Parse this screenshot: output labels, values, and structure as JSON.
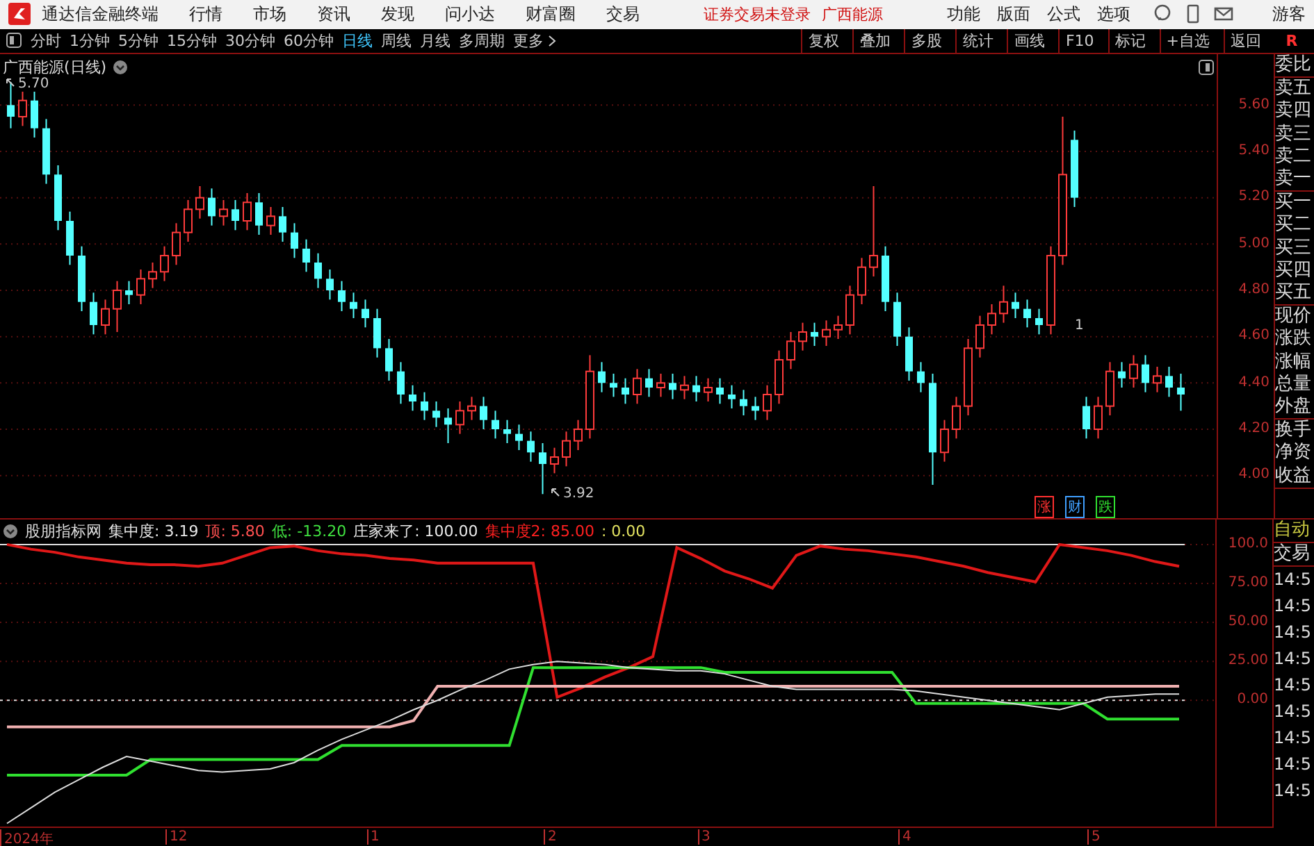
{
  "top_bar": {
    "app_name": "通达信金融终端",
    "menu": [
      "行情",
      "市场",
      "资讯",
      "发现",
      "问小达",
      "财富圈",
      "交易"
    ],
    "notice": "证券交易未登录",
    "stock_link": "广西能源",
    "right_menu": [
      "功能",
      "版面",
      "公式",
      "选项"
    ],
    "user": "游客"
  },
  "period_tabs": [
    {
      "label": "分时",
      "selected": false
    },
    {
      "label": "1分钟",
      "selected": false
    },
    {
      "label": "5分钟",
      "selected": false
    },
    {
      "label": "15分钟",
      "selected": false
    },
    {
      "label": "30分钟",
      "selected": false
    },
    {
      "label": "60分钟",
      "selected": false
    },
    {
      "label": "日线",
      "selected": true
    },
    {
      "label": "周线",
      "selected": false
    },
    {
      "label": "月线",
      "selected": false
    },
    {
      "label": "多周期",
      "selected": false
    },
    {
      "label": "更多",
      "selected": false
    }
  ],
  "tool_buttons": [
    "复权",
    "叠加",
    "多股",
    "统计",
    "画线",
    "F10",
    "标记",
    "+自选",
    "返回"
  ],
  "corner_label": "R",
  "main_chart": {
    "title": "广西能源(日线)",
    "high_label": "5.70",
    "low_label": "3.92",
    "note_mark": "1",
    "markers": [
      {
        "label": "涨",
        "color": "#ff3030"
      },
      {
        "label": "财",
        "color": "#40a0ff"
      },
      {
        "label": "跌",
        "color": "#30e030"
      }
    ],
    "chart_data": {
      "type": "candlestick",
      "grid": true,
      "ylim": [
        3.81,
        5.82
      ],
      "yticks": [
        {
          "value": 5.6,
          "label": "5.60"
        },
        {
          "value": 5.4,
          "label": "5.40"
        },
        {
          "value": 5.2,
          "label": "5.20"
        },
        {
          "value": 5.0,
          "label": "5.00"
        },
        {
          "value": 4.8,
          "label": "4.80"
        },
        {
          "value": 4.6,
          "label": "4.60"
        },
        {
          "value": 4.4,
          "label": "4.40"
        },
        {
          "value": 4.2,
          "label": "4.20"
        },
        {
          "value": 4.0,
          "label": "4.00"
        }
      ],
      "ohlc": [
        [
          5.6,
          5.7,
          5.5,
          5.55
        ],
        [
          5.55,
          5.66,
          5.51,
          5.62
        ],
        [
          5.62,
          5.66,
          5.46,
          5.5
        ],
        [
          5.5,
          5.54,
          5.26,
          5.3
        ],
        [
          5.3,
          5.34,
          5.06,
          5.1
        ],
        [
          5.1,
          5.14,
          4.91,
          4.95
        ],
        [
          4.95,
          4.99,
          4.71,
          4.75
        ],
        [
          4.75,
          4.79,
          4.61,
          4.65
        ],
        [
          4.65,
          4.76,
          4.61,
          4.72
        ],
        [
          4.72,
          4.84,
          4.62,
          4.8
        ],
        [
          4.8,
          4.84,
          4.74,
          4.78
        ],
        [
          4.78,
          4.89,
          4.74,
          4.85
        ],
        [
          4.85,
          4.92,
          4.81,
          4.88
        ],
        [
          4.88,
          4.99,
          4.84,
          4.95
        ],
        [
          4.95,
          5.09,
          4.91,
          5.05
        ],
        [
          5.05,
          5.19,
          5.01,
          5.15
        ],
        [
          5.15,
          5.25,
          5.11,
          5.2
        ],
        [
          5.2,
          5.24,
          5.08,
          5.12
        ],
        [
          5.12,
          5.19,
          5.08,
          5.15
        ],
        [
          5.15,
          5.19,
          5.06,
          5.1
        ],
        [
          5.1,
          5.22,
          5.06,
          5.18
        ],
        [
          5.18,
          5.22,
          5.04,
          5.08
        ],
        [
          5.08,
          5.16,
          5.04,
          5.12
        ],
        [
          5.12,
          5.16,
          5.01,
          5.05
        ],
        [
          5.05,
          5.09,
          4.94,
          4.98
        ],
        [
          4.98,
          5.02,
          4.88,
          4.92
        ],
        [
          4.92,
          4.96,
          4.81,
          4.85
        ],
        [
          4.85,
          4.89,
          4.76,
          4.8
        ],
        [
          4.8,
          4.84,
          4.71,
          4.75
        ],
        [
          4.75,
          4.79,
          4.68,
          4.72
        ],
        [
          4.72,
          4.76,
          4.64,
          4.68
        ],
        [
          4.68,
          4.72,
          4.51,
          4.55
        ],
        [
          4.55,
          4.59,
          4.41,
          4.45
        ],
        [
          4.45,
          4.49,
          4.31,
          4.35
        ],
        [
          4.35,
          4.39,
          4.28,
          4.32
        ],
        [
          4.32,
          4.36,
          4.24,
          4.28
        ],
        [
          4.28,
          4.32,
          4.21,
          4.25
        ],
        [
          4.25,
          4.29,
          4.14,
          4.22
        ],
        [
          4.22,
          4.32,
          4.18,
          4.28
        ],
        [
          4.28,
          4.34,
          4.24,
          4.3
        ],
        [
          4.3,
          4.34,
          4.2,
          4.24
        ],
        [
          4.24,
          4.28,
          4.16,
          4.2
        ],
        [
          4.2,
          4.24,
          4.14,
          4.18
        ],
        [
          4.18,
          4.22,
          4.11,
          4.15
        ],
        [
          4.15,
          4.19,
          4.06,
          4.1
        ],
        [
          4.1,
          4.14,
          3.92,
          4.05
        ],
        [
          4.05,
          4.12,
          4.01,
          4.08
        ],
        [
          4.08,
          4.19,
          4.04,
          4.15
        ],
        [
          4.15,
          4.24,
          4.11,
          4.2
        ],
        [
          4.2,
          4.52,
          4.16,
          4.45
        ],
        [
          4.45,
          4.49,
          4.36,
          4.4
        ],
        [
          4.4,
          4.44,
          4.34,
          4.38
        ],
        [
          4.38,
          4.42,
          4.31,
          4.35
        ],
        [
          4.35,
          4.46,
          4.31,
          4.42
        ],
        [
          4.42,
          4.46,
          4.34,
          4.38
        ],
        [
          4.38,
          4.44,
          4.34,
          4.4
        ],
        [
          4.4,
          4.44,
          4.33,
          4.37
        ],
        [
          4.37,
          4.43,
          4.33,
          4.39
        ],
        [
          4.39,
          4.43,
          4.32,
          4.36
        ],
        [
          4.36,
          4.42,
          4.32,
          4.38
        ],
        [
          4.38,
          4.42,
          4.31,
          4.35
        ],
        [
          4.35,
          4.39,
          4.29,
          4.33
        ],
        [
          4.33,
          4.37,
          4.26,
          4.3
        ],
        [
          4.3,
          4.34,
          4.24,
          4.28
        ],
        [
          4.28,
          4.39,
          4.24,
          4.35
        ],
        [
          4.35,
          4.54,
          4.31,
          4.5
        ],
        [
          4.5,
          4.62,
          4.46,
          4.58
        ],
        [
          4.58,
          4.66,
          4.54,
          4.62
        ],
        [
          4.62,
          4.66,
          4.56,
          4.6
        ],
        [
          4.6,
          4.67,
          4.56,
          4.63
        ],
        [
          4.63,
          4.69,
          4.59,
          4.65
        ],
        [
          4.65,
          4.82,
          4.61,
          4.78
        ],
        [
          4.78,
          4.94,
          4.74,
          4.9
        ],
        [
          4.9,
          5.25,
          4.86,
          4.95
        ],
        [
          4.95,
          4.99,
          4.71,
          4.75
        ],
        [
          4.75,
          4.79,
          4.56,
          4.6
        ],
        [
          4.6,
          4.64,
          4.41,
          4.45
        ],
        [
          4.45,
          4.49,
          4.36,
          4.4
        ],
        [
          4.4,
          4.44,
          3.96,
          4.1
        ],
        [
          4.1,
          4.24,
          4.06,
          4.2
        ],
        [
          4.2,
          4.34,
          4.16,
          4.3
        ],
        [
          4.3,
          4.59,
          4.26,
          4.55
        ],
        [
          4.55,
          4.69,
          4.51,
          4.65
        ],
        [
          4.65,
          4.74,
          4.61,
          4.7
        ],
        [
          4.7,
          4.82,
          4.66,
          4.75
        ],
        [
          4.75,
          4.79,
          4.68,
          4.72
        ],
        [
          4.72,
          4.76,
          4.64,
          4.68
        ],
        [
          4.68,
          4.72,
          4.61,
          4.65
        ],
        [
          4.65,
          4.99,
          4.61,
          4.95
        ],
        [
          4.95,
          5.55,
          4.91,
          5.3
        ],
        [
          5.45,
          5.49,
          5.16,
          5.2
        ],
        [
          4.3,
          4.34,
          4.16,
          4.2
        ],
        [
          4.2,
          4.34,
          4.16,
          4.3
        ],
        [
          4.3,
          4.49,
          4.26,
          4.45
        ],
        [
          4.45,
          4.49,
          4.38,
          4.42
        ],
        [
          4.42,
          4.52,
          4.38,
          4.48
        ],
        [
          4.48,
          4.52,
          4.36,
          4.4
        ],
        [
          4.4,
          4.47,
          4.36,
          4.43
        ],
        [
          4.43,
          4.47,
          4.34,
          4.38
        ],
        [
          4.38,
          4.44,
          4.28,
          4.35
        ]
      ]
    }
  },
  "quote_panel": [
    [
      "委比"
    ],
    [
      "卖五",
      "卖四",
      "卖三",
      "卖二",
      "卖一"
    ],
    [
      "买一",
      "买二",
      "买三",
      "买四",
      "买五"
    ],
    [
      "现价",
      "涨跌",
      "涨幅",
      "总量",
      "外盘"
    ],
    [
      "换手",
      "净资",
      "收益"
    ]
  ],
  "indicator": {
    "name": "股朋指标网",
    "values": [
      {
        "text": "集中度: 3.19",
        "color": "#e8e8e8"
      },
      {
        "text": "顶: 5.80",
        "color": "#ff5050"
      },
      {
        "text": "低: -13.20",
        "color": "#40e040"
      },
      {
        "text": "庄家来了: 100.00",
        "color": "#e8e8e8"
      },
      {
        "text": "集中度2: 85.00",
        "color": "#ff2020"
      },
      {
        "text": ": 0.00",
        "color": "#e0e060"
      }
    ],
    "chart_data": {
      "type": "line",
      "grid": true,
      "ylim": [
        -81,
        116
      ],
      "ref_lines": [
        {
          "axis": "y",
          "value": 100,
          "color": "#dddddd"
        },
        {
          "axis": "y",
          "value": 0,
          "color": "#dddddd"
        }
      ],
      "yticks": [
        {
          "value": 100,
          "label": "100.0"
        },
        {
          "value": 75,
          "label": "75.00"
        },
        {
          "value": 50,
          "label": "50.00"
        },
        {
          "value": 25,
          "label": "25.00"
        },
        {
          "value": 0,
          "label": "0.00"
        }
      ],
      "series": [
        {
          "color": "#e01818",
          "values": [
            100,
            97,
            95,
            92,
            90,
            88,
            87,
            87,
            86,
            88,
            93,
            98,
            99,
            96,
            94,
            93,
            91,
            90,
            88,
            88,
            88,
            88,
            88,
            2,
            8,
            15,
            21,
            28,
            98,
            91,
            83,
            78,
            72,
            93,
            99,
            97,
            96,
            94,
            92,
            89,
            86,
            82,
            79,
            76,
            100,
            98,
            96,
            93,
            89,
            86
          ]
        },
        {
          "color": "#30e030",
          "values": [
            -48,
            -48,
            -48,
            -48,
            -48,
            -48,
            -38,
            -38,
            -38,
            -38,
            -38,
            -38,
            -38,
            -38,
            -29,
            -29,
            -29,
            -29,
            -29,
            -29,
            -29,
            -29,
            21,
            21,
            21,
            21,
            21,
            21,
            21,
            21,
            18,
            18,
            18,
            18,
            18,
            18,
            18,
            18,
            -2,
            -2,
            -2,
            -2,
            -2,
            -2,
            -2,
            -2,
            -12,
            -12,
            -12,
            -12
          ]
        },
        {
          "color": "#f0b0b0",
          "values": [
            -17,
            -17,
            -17,
            -17,
            -17,
            -17,
            -17,
            -17,
            -17,
            -17,
            -17,
            -17,
            -17,
            -17,
            -17,
            -17,
            -17,
            -13,
            9,
            9,
            9,
            9,
            9,
            9,
            9,
            9,
            9,
            9,
            9,
            9,
            9,
            9,
            9,
            9,
            9,
            9,
            9,
            9,
            9,
            9,
            9,
            9,
            9,
            9,
            9,
            9,
            9,
            9,
            9,
            9
          ]
        },
        {
          "color": "#dddddd",
          "values": [
            -79,
            -69,
            -59,
            -51,
            -43,
            -36,
            -39,
            -42,
            -45,
            -46,
            -45,
            -44,
            -40,
            -32,
            -25,
            -19,
            -13,
            -6,
            0,
            7,
            13,
            20,
            23,
            25,
            24,
            23,
            21,
            20,
            19,
            19,
            17,
            13,
            9,
            7,
            7,
            7,
            7,
            7,
            6,
            4,
            2,
            0,
            -2,
            -4,
            -6,
            -2,
            2,
            3,
            4,
            4
          ]
        }
      ]
    }
  },
  "x_axis": [
    "2024年",
    "12",
    "1",
    "2",
    "3",
    "4",
    "5"
  ],
  "trade_panel": {
    "auto": "自动",
    "title": "交易",
    "times": [
      "14:5",
      "14:5",
      "14:5",
      "14:5",
      "14:5",
      "14:5",
      "14:5",
      "14:5",
      "14:5"
    ]
  }
}
